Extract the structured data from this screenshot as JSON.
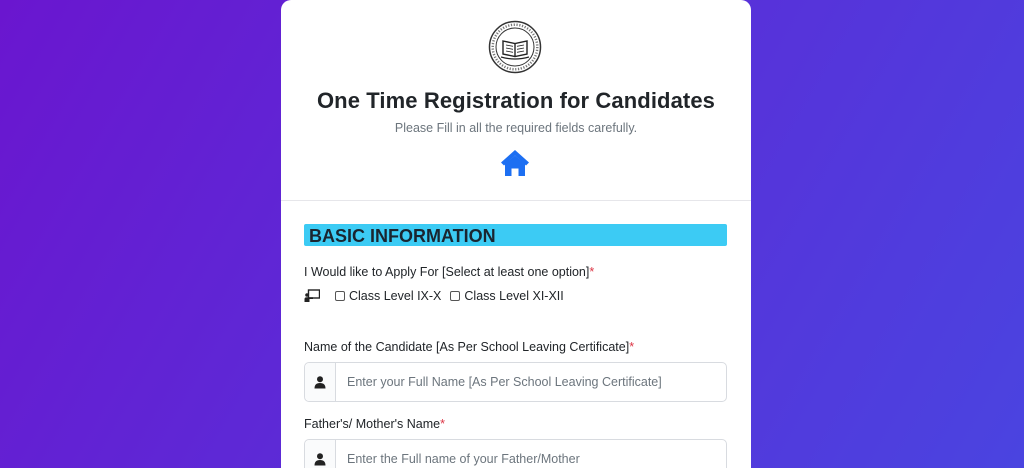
{
  "header": {
    "title": "One Time Registration for Candidates",
    "subtitle": "Please Fill in all the required fields carefully.",
    "logo_icon": "emblem-book-seal-icon",
    "home_icon": "home-icon"
  },
  "section": {
    "heading": "BASIC INFORMATION",
    "heading_bg": "#3ccbf4"
  },
  "apply_for": {
    "label": "I Would like to Apply For [Select at least one option]",
    "required_mark": "*",
    "icon": "presentation-icon",
    "options": [
      {
        "label": "Class Level IX-X",
        "checked": false
      },
      {
        "label": "Class Level XI-XII",
        "checked": false
      }
    ]
  },
  "candidate_name": {
    "label": "Name of the Candidate [As Per School Leaving Certificate]",
    "required_mark": "*",
    "icon": "user-icon",
    "value": "",
    "placeholder": "Enter your Full Name [As Per School Leaving Certificate]"
  },
  "parent_name": {
    "label": "Father's/ Mother's Name",
    "required_mark": "*",
    "icon": "user-icon",
    "value": "",
    "placeholder": "Enter the Full name of your Father/Mother"
  },
  "colors": {
    "background_gradient_start": "#6a16cf",
    "background_gradient_end": "#4a44e0",
    "accent": "#1d6ff2",
    "required": "#dc3545"
  }
}
